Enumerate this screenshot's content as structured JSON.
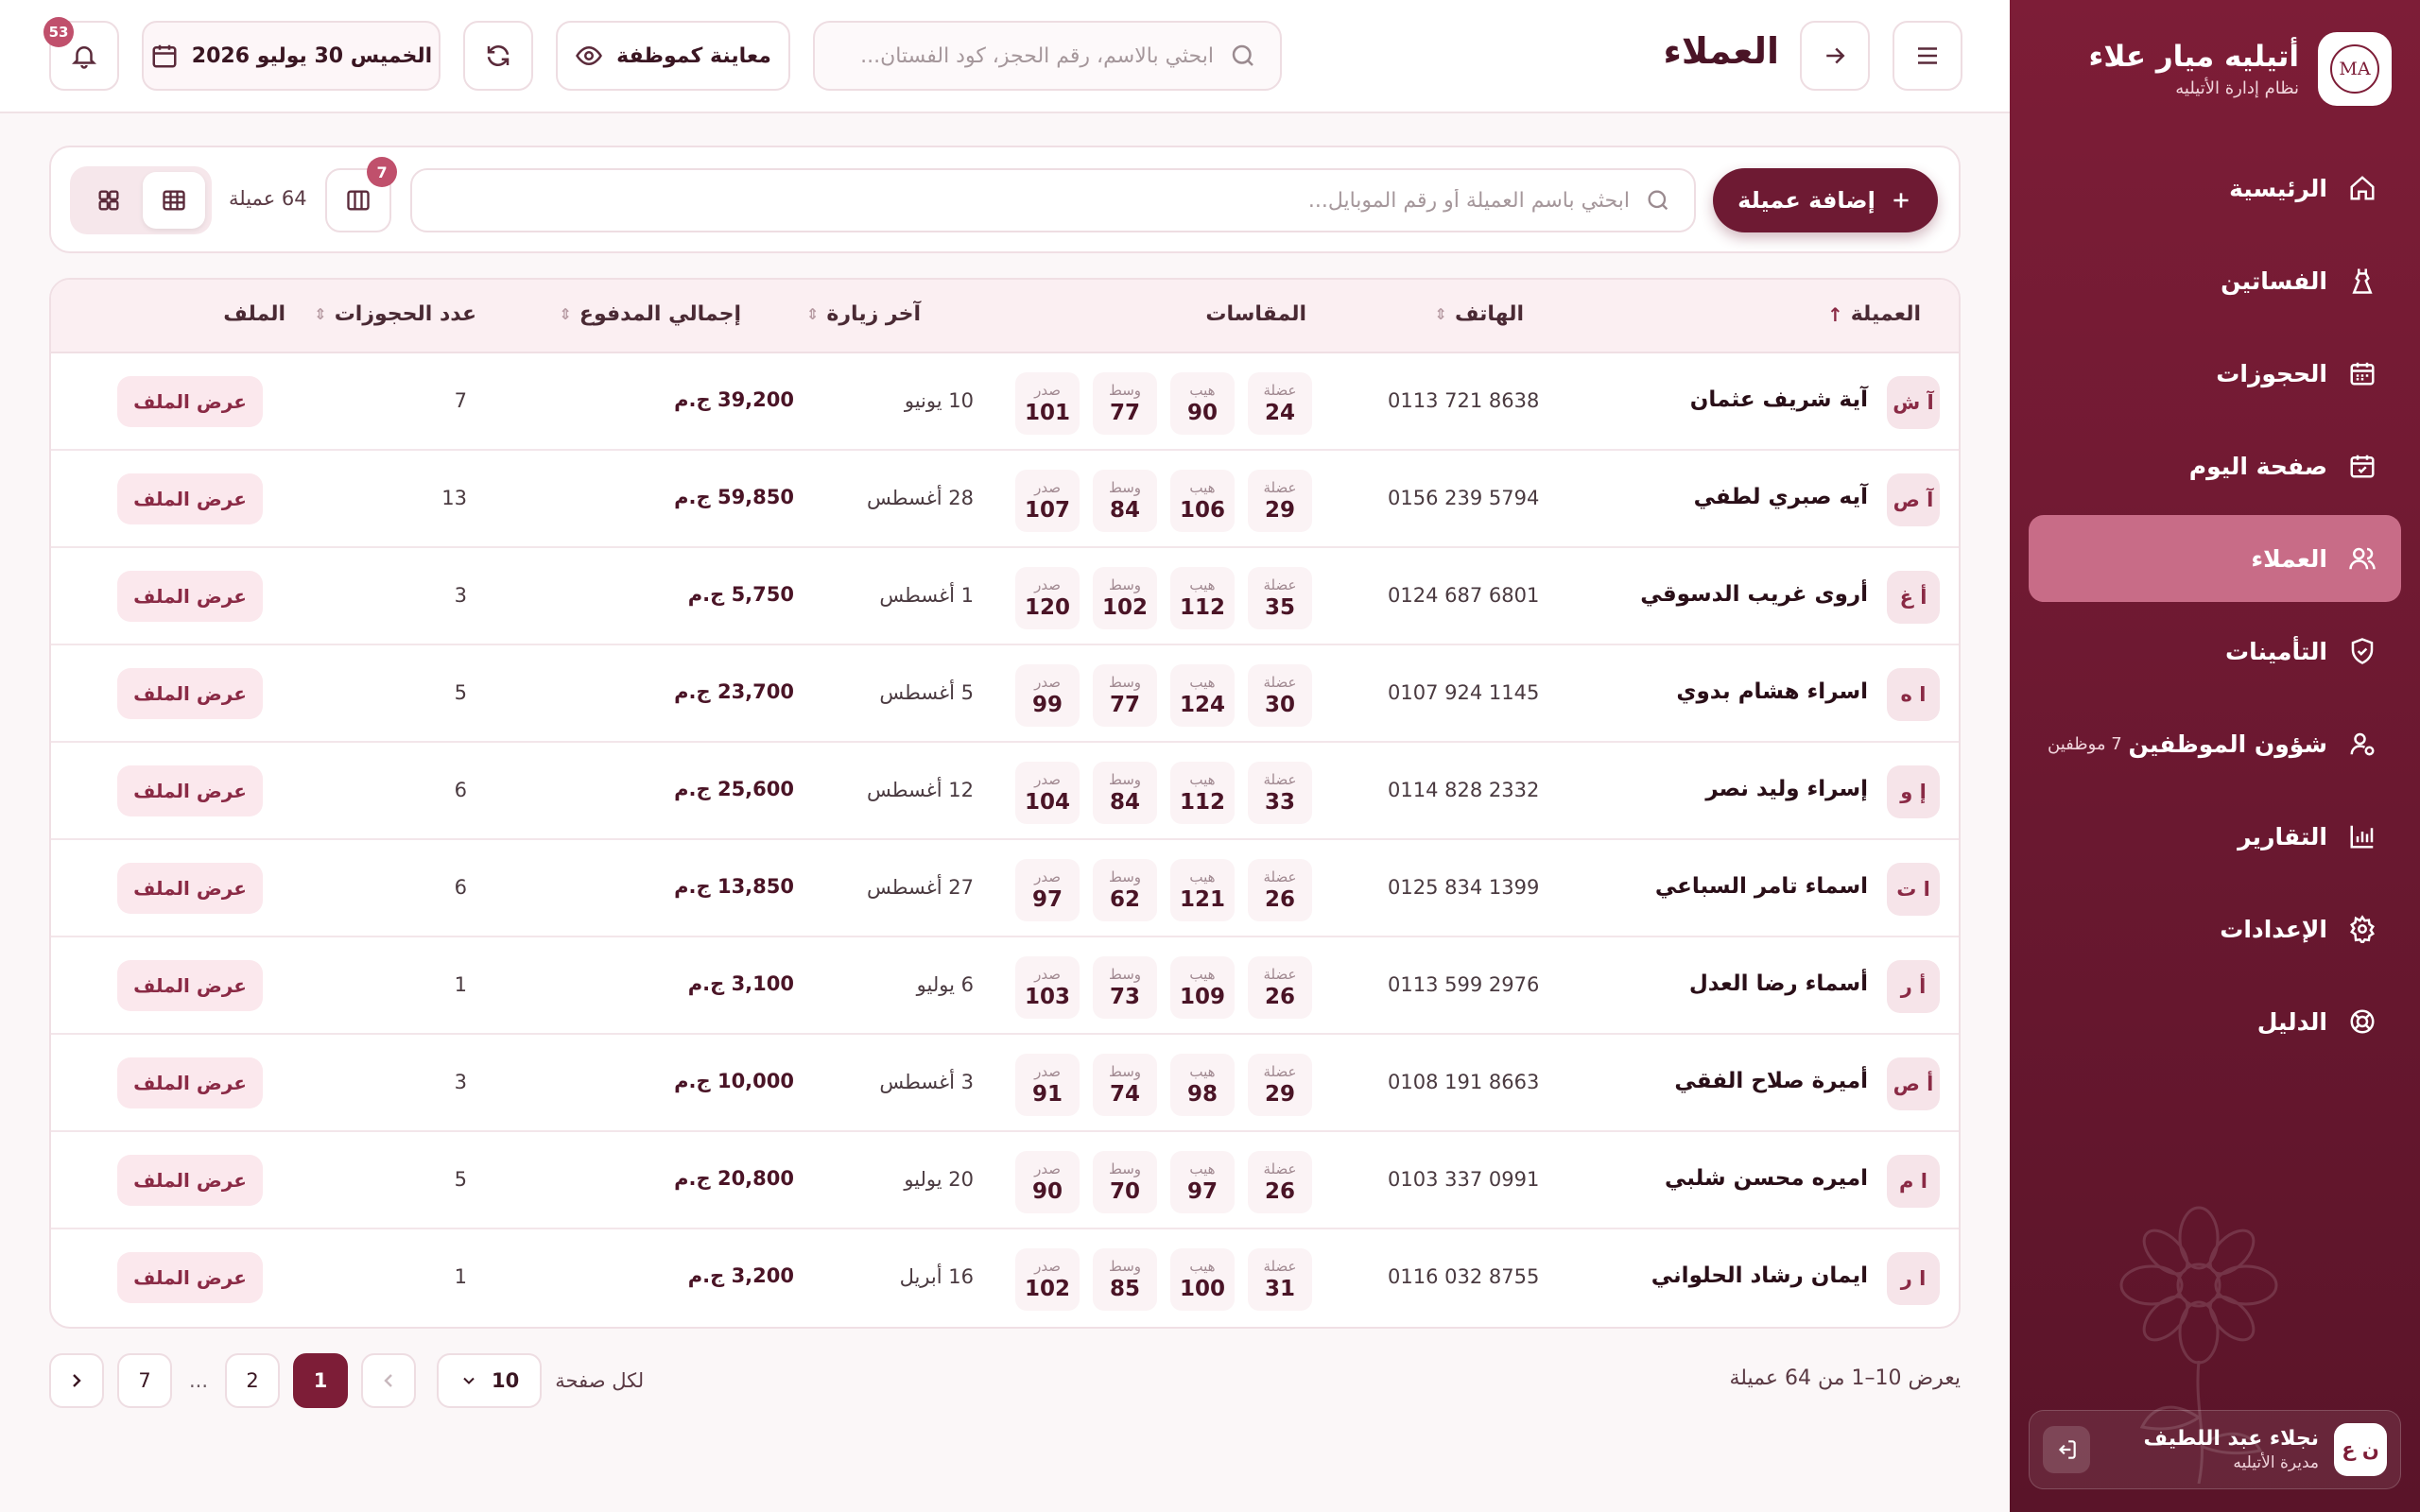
{
  "brand": {
    "name": "أتيليه ميار علاء",
    "subtitle": "نظام إدارة الأتيليه",
    "logo_text": "MA"
  },
  "sidebar": {
    "items": [
      {
        "label": "الرئيسية",
        "icon": "home-icon"
      },
      {
        "label": "الفساتين",
        "icon": "dress-icon"
      },
      {
        "label": "الحجوزات",
        "icon": "calendar-icon"
      },
      {
        "label": "صفحة اليوم",
        "icon": "calendar-check-icon"
      },
      {
        "label": "العملاء",
        "icon": "users-icon",
        "active": true
      },
      {
        "label": "التأمينات",
        "icon": "shield-icon"
      },
      {
        "label": "شؤون الموظفين",
        "icon": "user-gear-icon",
        "badge": "7 موظفين"
      },
      {
        "label": "التقارير",
        "icon": "chart-icon"
      },
      {
        "label": "الإعدادات",
        "icon": "gear-icon"
      },
      {
        "label": "الدليل",
        "icon": "lifebuoy-icon"
      }
    ]
  },
  "user": {
    "name": "نجلاء عبد اللطيف",
    "role": "مديرة الأتيليه",
    "initials": "ن ع"
  },
  "header": {
    "title": "العملاء",
    "search_placeholder": "ابحثي بالاسم، رقم الحجز، كود الفستان...",
    "preview_label": "معاينة كموظفة",
    "date_label": "الخميس 30 يوليو 2026",
    "notifications": "53"
  },
  "toolbar": {
    "add_label": "إضافة عميلة",
    "search_placeholder": "ابحثي باسم العميلة أو رقم الموبايل...",
    "count_label": "64 عميلة",
    "columns_badge": "7"
  },
  "table": {
    "headers": {
      "client": "العميلة",
      "phone": "الهاتف",
      "measurements": "المقاسات",
      "last_visit": "آخر زيارة",
      "total_paid": "إجمالي المدفوع",
      "bookings": "عدد الحجوزات",
      "file": "الملف"
    },
    "measure_labels": {
      "bust": "صدر",
      "waist": "وسط",
      "hip": "هيب",
      "arm": "عضلة"
    },
    "file_button": "عرض الملف",
    "rows": [
      {
        "initials": "آ ش",
        "name": "آية شريف عثمان",
        "phone": "0113 721 8638",
        "bust": "101",
        "waist": "77",
        "hip": "90",
        "arm": "24",
        "last_visit": "10 يونيو",
        "paid": "39,200 ج.م",
        "bookings": "7"
      },
      {
        "initials": "آ ص",
        "name": "آيه صبري لطفي",
        "phone": "0156 239 5794",
        "bust": "107",
        "waist": "84",
        "hip": "106",
        "arm": "29",
        "last_visit": "28 أغسطس",
        "paid": "59,850 ج.م",
        "bookings": "13"
      },
      {
        "initials": "أ غ",
        "name": "أروى غريب الدسوقي",
        "phone": "0124 687 6801",
        "bust": "120",
        "waist": "102",
        "hip": "112",
        "arm": "35",
        "last_visit": "1 أغسطس",
        "paid": "5,750 ج.م",
        "bookings": "3"
      },
      {
        "initials": "ا ه",
        "name": "اسراء هشام بدوي",
        "phone": "0107 924 1145",
        "bust": "99",
        "waist": "77",
        "hip": "124",
        "arm": "30",
        "last_visit": "5 أغسطس",
        "paid": "23,700 ج.م",
        "bookings": "5"
      },
      {
        "initials": "إ و",
        "name": "إسراء وليد نصر",
        "phone": "0114 828 2332",
        "bust": "104",
        "waist": "84",
        "hip": "112",
        "arm": "33",
        "last_visit": "12 أغسطس",
        "paid": "25,600 ج.م",
        "bookings": "6"
      },
      {
        "initials": "ا ت",
        "name": "اسماء تامر السباعي",
        "phone": "0125 834 1399",
        "bust": "97",
        "waist": "62",
        "hip": "121",
        "arm": "26",
        "last_visit": "27 أغسطس",
        "paid": "13,850 ج.م",
        "bookings": "6"
      },
      {
        "initials": "أ ر",
        "name": "أسماء رضا العدل",
        "phone": "0113 599 2976",
        "bust": "103",
        "waist": "73",
        "hip": "109",
        "arm": "26",
        "last_visit": "6 يوليو",
        "paid": "3,100 ج.م",
        "bookings": "1"
      },
      {
        "initials": "أ ص",
        "name": "أميرة صلاح الفقي",
        "phone": "0108 191 8663",
        "bust": "91",
        "waist": "74",
        "hip": "98",
        "arm": "29",
        "last_visit": "3 أغسطس",
        "paid": "10,000 ج.م",
        "bookings": "3"
      },
      {
        "initials": "ا م",
        "name": "اميره محسن شلبي",
        "phone": "0103 337 0991",
        "bust": "90",
        "waist": "70",
        "hip": "97",
        "arm": "26",
        "last_visit": "20 يوليو",
        "paid": "20,800 ج.م",
        "bookings": "5"
      },
      {
        "initials": "ا ر",
        "name": "ايمان رشاد الحلواني",
        "phone": "0116 032 8755",
        "bust": "102",
        "waist": "85",
        "hip": "100",
        "arm": "31",
        "last_visit": "16 أبريل",
        "paid": "3,200 ج.م",
        "bookings": "1"
      }
    ]
  },
  "pagination": {
    "summary": "يعرض 10–1 من 64 عميلة",
    "per_page_label": "لكل صفحة",
    "per_page_value": "10",
    "pages": [
      "1",
      "2",
      "...",
      "7"
    ],
    "current": "1"
  },
  "colors": {
    "primary": "#7d1d37",
    "accent": "#c86c87",
    "badge": "#c0506c"
  }
}
